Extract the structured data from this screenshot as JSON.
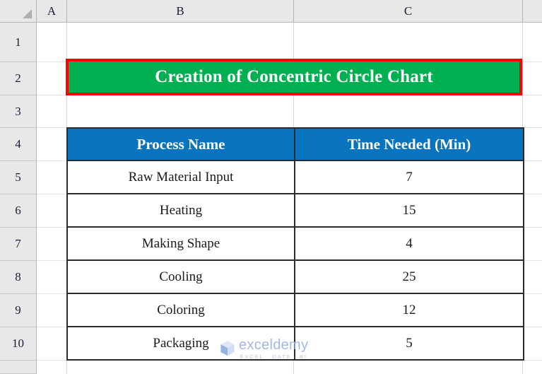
{
  "spreadsheet": {
    "column_headers": [
      "A",
      "B",
      "C"
    ],
    "row_headers": [
      "1",
      "2",
      "3",
      "4",
      "5",
      "6",
      "7",
      "8",
      "9",
      "10"
    ],
    "select_all_icon": "select-all-triangle"
  },
  "title_banner": {
    "text": "Creation of Concentric Circle Chart",
    "fill_color": "#00B050",
    "border_color": "#FF0000",
    "text_color": "#FFFFFF"
  },
  "table": {
    "header_fill": "#0873BE",
    "header_text_color": "#FFFFFF",
    "border_color": "#2B2B2B",
    "columns": [
      "Process Name",
      "Time Needed (Min)"
    ],
    "rows": [
      {
        "process": "Raw Material Input",
        "time": "7"
      },
      {
        "process": "Heating",
        "time": "15"
      },
      {
        "process": "Making Shape",
        "time": "4"
      },
      {
        "process": "Cooling",
        "time": "25"
      },
      {
        "process": "Coloring",
        "time": "12"
      },
      {
        "process": "Packaging",
        "time": "5"
      }
    ]
  },
  "watermark": {
    "name": "exceldemy",
    "tagline": "EXCEL · DATA · BI",
    "name_color": "#9FB4E8",
    "tagline_color": "#B9C4D6",
    "logo_icon": "exceldemy-cube-logo"
  },
  "chart_data": {
    "type": "table",
    "title": "Creation of Concentric Circle Chart",
    "categories": [
      "Raw Material Input",
      "Heating",
      "Making Shape",
      "Cooling",
      "Coloring",
      "Packaging"
    ],
    "values": [
      7,
      15,
      4,
      25,
      12,
      5
    ],
    "xlabel": "Process Name",
    "ylabel": "Time Needed (Min)"
  }
}
